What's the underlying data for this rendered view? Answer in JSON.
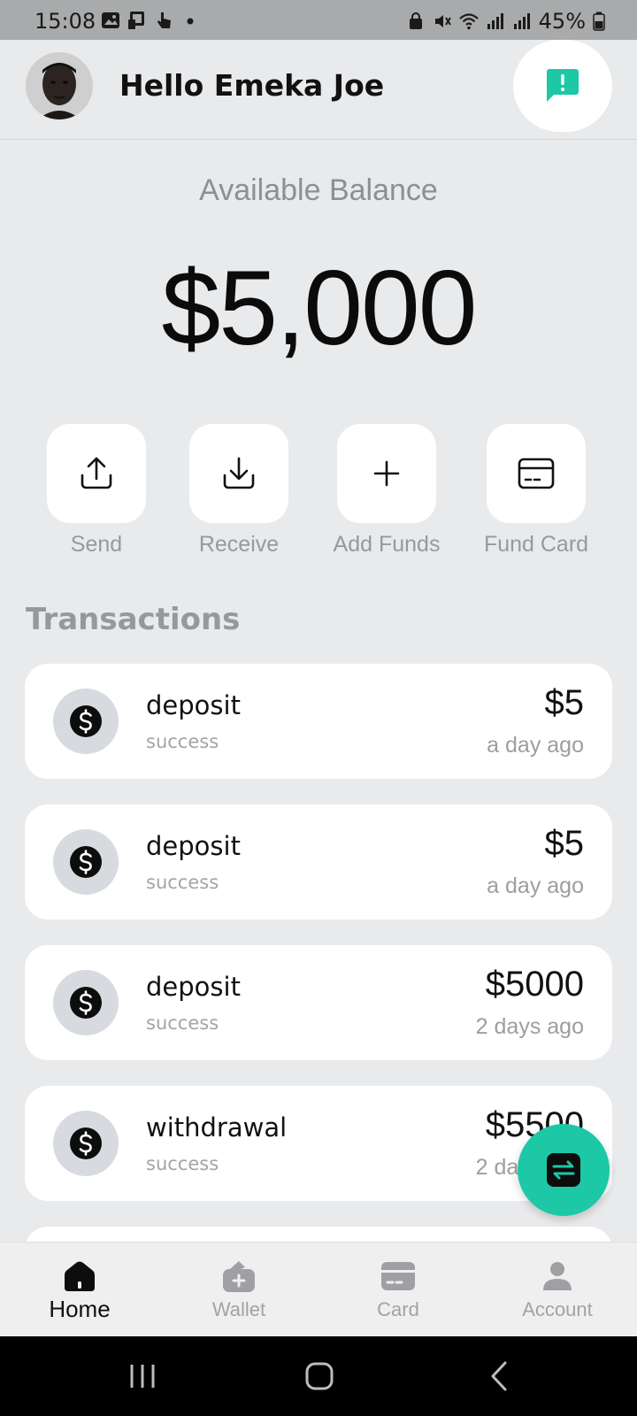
{
  "status_bar": {
    "time": "15:08",
    "battery": "45%",
    "left_icons": [
      "image-icon",
      "cast-icon",
      "gesture-icon",
      "dot-icon"
    ],
    "right_icons": [
      "lock-icon",
      "mute-icon",
      "wifi-icon",
      "signal-icon",
      "signal-icon",
      "battery-icon"
    ]
  },
  "header": {
    "greeting": "Hello Emeka Joe",
    "notification_icon": "message-alert-icon",
    "accent_color": "#1dc8a6"
  },
  "balance": {
    "label": "Available Balance",
    "amount": "$5,000"
  },
  "actions": [
    {
      "label": "Send",
      "icon": "upload-icon"
    },
    {
      "label": "Receive",
      "icon": "download-icon"
    },
    {
      "label": "Add Funds",
      "icon": "plus-icon"
    },
    {
      "label": "Fund Card",
      "icon": "card-icon"
    }
  ],
  "transactions": {
    "title": "Transactions",
    "items": [
      {
        "type": "deposit",
        "status": "success",
        "amount": "$5",
        "time": "a day ago"
      },
      {
        "type": "deposit",
        "status": "success",
        "amount": "$5",
        "time": "a day ago"
      },
      {
        "type": "deposit",
        "status": "success",
        "amount": "$5000",
        "time": "2 days ago"
      },
      {
        "type": "withdrawal",
        "status": "success",
        "amount": "$5500",
        "time": "2 days ago"
      }
    ]
  },
  "fab": {
    "icon": "swap-icon"
  },
  "bottom_nav": [
    {
      "label": "Home",
      "icon": "home-icon",
      "active": true
    },
    {
      "label": "Wallet",
      "icon": "wallet-icon",
      "active": false
    },
    {
      "label": "Card",
      "icon": "card-icon",
      "active": false
    },
    {
      "label": "Account",
      "icon": "user-icon",
      "active": false
    }
  ]
}
